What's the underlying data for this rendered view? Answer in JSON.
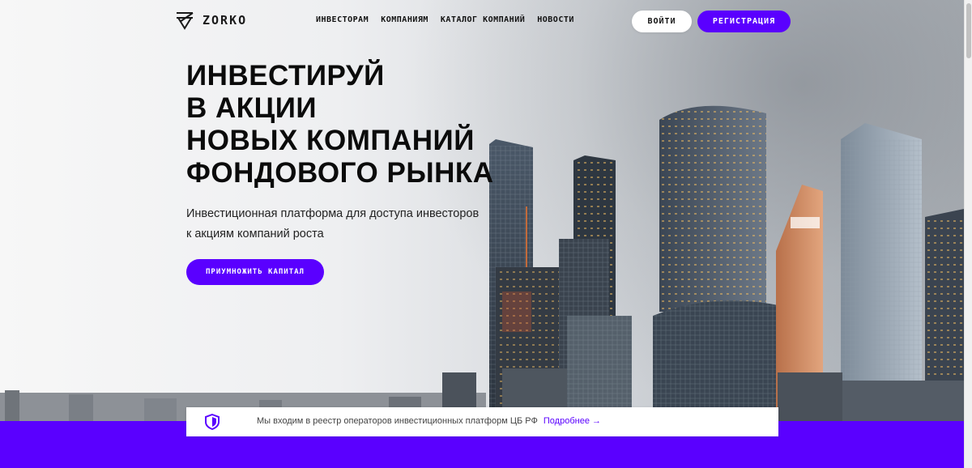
{
  "brand": {
    "name": "ZORKO",
    "logo_icon": "zorko-logo-icon"
  },
  "nav": {
    "items": [
      {
        "label": "ИНВЕСТОРАМ"
      },
      {
        "label": "КОМПАНИЯМ"
      },
      {
        "label": "КАТАЛОГ КОМПАНИЙ"
      },
      {
        "label": "НОВОСТИ"
      }
    ],
    "login_label": "ВОЙТИ",
    "register_label": "РЕГИСТРАЦИЯ"
  },
  "hero": {
    "headline": [
      "ИНВЕСТИРУЙ",
      "В АКЦИИ",
      "НОВЫХ КОМПАНИЙ",
      "ФОНДОВОГО РЫНКА"
    ],
    "subtitle_line1": "Инвестиционная платформа для доступа инвесторов",
    "subtitle_line2": "к акциям компаний роста",
    "cta_label": "ПРИУМНОЖИТЬ КАПИТАЛ"
  },
  "notice": {
    "icon": "shield-icon",
    "text": "Мы входим в реестр операторов инвестиционных платформ ЦБ РФ",
    "link_label": "Подробнее →"
  },
  "colors": {
    "accent": "#5a00ff",
    "text": "#0b0b0b",
    "background": "#ffffff"
  }
}
